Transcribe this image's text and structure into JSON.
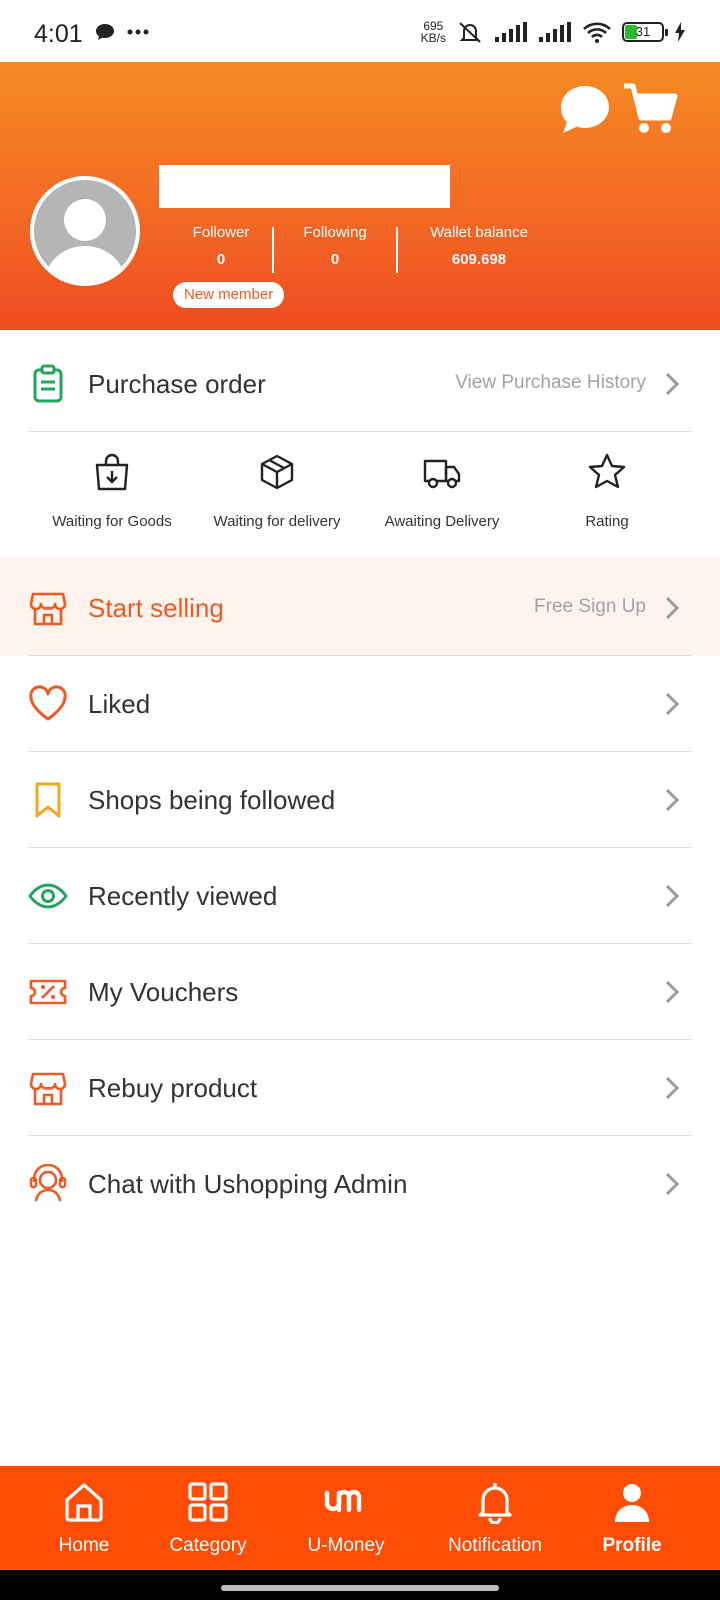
{
  "status_bar": {
    "time": "4:01",
    "speed_value": "695",
    "speed_unit": "KB/s",
    "battery": "31"
  },
  "header": {
    "stats": [
      {
        "label": "Follower",
        "value": "0"
      },
      {
        "label": "Following",
        "value": "0"
      },
      {
        "label": "Wallet balance",
        "value": "609.698"
      }
    ],
    "badge": "New member"
  },
  "purchase": {
    "title": "Purchase order",
    "hint": "View Purchase History"
  },
  "orders": [
    {
      "label": "Waiting for Goods",
      "icon": "bag-download-icon"
    },
    {
      "label": "Waiting for delivery",
      "icon": "box-icon"
    },
    {
      "label": "Awaiting Delivery",
      "icon": "truck-icon"
    },
    {
      "label": "Rating",
      "icon": "star-icon"
    }
  ],
  "sell": {
    "title": "Start selling",
    "hint": "Free Sign Up"
  },
  "menu": [
    {
      "label": "Liked",
      "icon": "heart-icon"
    },
    {
      "label": "Shops being followed",
      "icon": "bookmark-icon"
    },
    {
      "label": "Recently viewed",
      "icon": "eye-icon"
    },
    {
      "label": "My Vouchers",
      "icon": "voucher-icon"
    },
    {
      "label": "Rebuy product",
      "icon": "store-icon"
    },
    {
      "label": "Chat with Ushopping Admin",
      "icon": "support-icon"
    }
  ],
  "nav": [
    {
      "label": "Home",
      "icon": "home-icon"
    },
    {
      "label": "Category",
      "icon": "grid-icon"
    },
    {
      "label": "U-Money",
      "icon": "umoney-icon"
    },
    {
      "label": "Notification",
      "icon": "bell-icon"
    },
    {
      "label": "Profile",
      "icon": "profile-icon"
    }
  ],
  "colors": {
    "brand": "#ff4d05",
    "header_top": "#f58a22",
    "header_bottom": "#ef4b22",
    "green": "#22a55a",
    "yellow": "#f2a81d"
  }
}
